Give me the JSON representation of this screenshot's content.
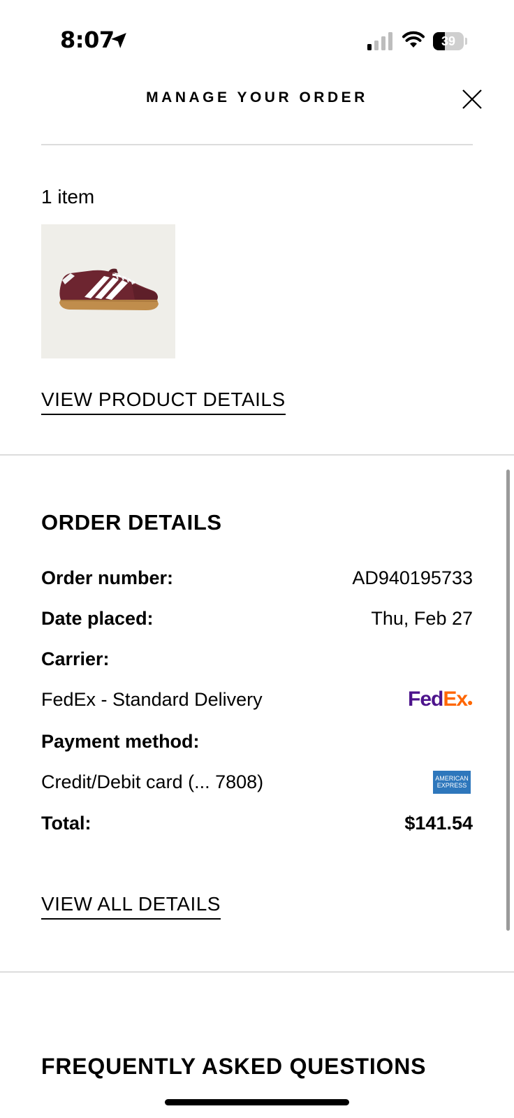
{
  "status_bar": {
    "time": "8:07",
    "battery_level": "39",
    "battery_fraction": 0.39
  },
  "header": {
    "title": "MANAGE YOUR ORDER"
  },
  "items": {
    "count_label": "1 item",
    "product_image_desc": "burgundy suede sneaker with white stripes and gum sole",
    "view_product_label": "VIEW PRODUCT DETAILS"
  },
  "order_details": {
    "title": "ORDER DETAILS",
    "order_number_label": "Order number:",
    "order_number_value": "AD940195733",
    "date_placed_label": "Date placed:",
    "date_placed_value": "Thu, Feb 27",
    "carrier_label": "Carrier:",
    "carrier_value": "FedEx - Standard Delivery",
    "carrier_logo_fed": "Fed",
    "carrier_logo_ex": "Ex",
    "payment_label": "Payment method:",
    "payment_value": "Credit/Debit card (... 7808)",
    "payment_logo_line1": "AMERICAN",
    "payment_logo_line2": "EXPRESS",
    "total_label": "Total:",
    "total_value": "$141.54",
    "view_all_label": "VIEW ALL DETAILS"
  },
  "faq": {
    "title": "FREQUENTLY ASKED QUESTIONS"
  },
  "colors": {
    "fedex_purple": "#4d148c",
    "fedex_orange": "#ff6600",
    "amex_blue": "#2e77bc",
    "divider": "#dcdcdc",
    "thumb_bg": "#efeee9"
  }
}
